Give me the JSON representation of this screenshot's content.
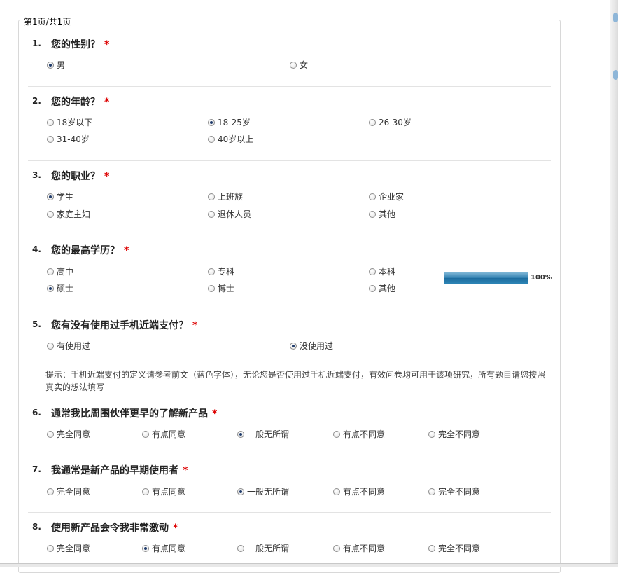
{
  "pager": "第1页/共1页",
  "required_mark": "*",
  "progress": {
    "percent": 100,
    "label": "100%"
  },
  "questions": [
    {
      "num": "1.",
      "title": "您的性别？",
      "options": [
        {
          "label": "男",
          "checked": true
        },
        {
          "label": "女",
          "checked": false
        }
      ]
    },
    {
      "num": "2.",
      "title": "您的年龄？",
      "options": [
        {
          "label": "18岁以下",
          "checked": false
        },
        {
          "label": "18-25岁",
          "checked": true
        },
        {
          "label": "26-30岁",
          "checked": false
        },
        {
          "label": "31-40岁",
          "checked": false
        },
        {
          "label": "40岁以上",
          "checked": false
        }
      ]
    },
    {
      "num": "3.",
      "title": "您的职业？",
      "options": [
        {
          "label": "学生",
          "checked": true
        },
        {
          "label": "上班族",
          "checked": false
        },
        {
          "label": "企业家",
          "checked": false
        },
        {
          "label": "家庭主妇",
          "checked": false
        },
        {
          "label": "退休人员",
          "checked": false
        },
        {
          "label": "其他",
          "checked": false
        }
      ]
    },
    {
      "num": "4.",
      "title": "您的最高学历？",
      "options": [
        {
          "label": "高中",
          "checked": false
        },
        {
          "label": "专科",
          "checked": false
        },
        {
          "label": "本科",
          "checked": false
        },
        {
          "label": "硕士",
          "checked": true
        },
        {
          "label": "博士",
          "checked": false
        },
        {
          "label": "其他",
          "checked": false
        }
      ]
    },
    {
      "num": "5.",
      "title": "您有没有使用过手机近端支付？",
      "options": [
        {
          "label": "有使用过",
          "checked": false
        },
        {
          "label": "没使用过",
          "checked": true
        }
      ],
      "hint": "提示：手机近端支付的定义请参考前文（蓝色字体），无论您是否使用过手机近端支付，有效问卷均可用于该项研究，所有题目请您按照真实的想法填写"
    },
    {
      "num": "6.",
      "title": "通常我比周围伙伴更早的了解新产品",
      "options": [
        {
          "label": "完全同意",
          "checked": false
        },
        {
          "label": "有点同意",
          "checked": false
        },
        {
          "label": "一般无所谓",
          "checked": true
        },
        {
          "label": "有点不同意",
          "checked": false
        },
        {
          "label": "完全不同意",
          "checked": false
        }
      ]
    },
    {
      "num": "7.",
      "title": "我通常是新产品的早期使用者",
      "options": [
        {
          "label": "完全同意",
          "checked": false
        },
        {
          "label": "有点同意",
          "checked": false
        },
        {
          "label": "一般无所谓",
          "checked": true
        },
        {
          "label": "有点不同意",
          "checked": false
        },
        {
          "label": "完全不同意",
          "checked": false
        }
      ]
    },
    {
      "num": "8.",
      "title": "使用新产品会令我非常激动",
      "options": [
        {
          "label": "完全同意",
          "checked": false
        },
        {
          "label": "有点同意",
          "checked": true
        },
        {
          "label": "一般无所谓",
          "checked": false
        },
        {
          "label": "有点不同意",
          "checked": false
        },
        {
          "label": "完全不同意",
          "checked": false
        }
      ]
    }
  ]
}
